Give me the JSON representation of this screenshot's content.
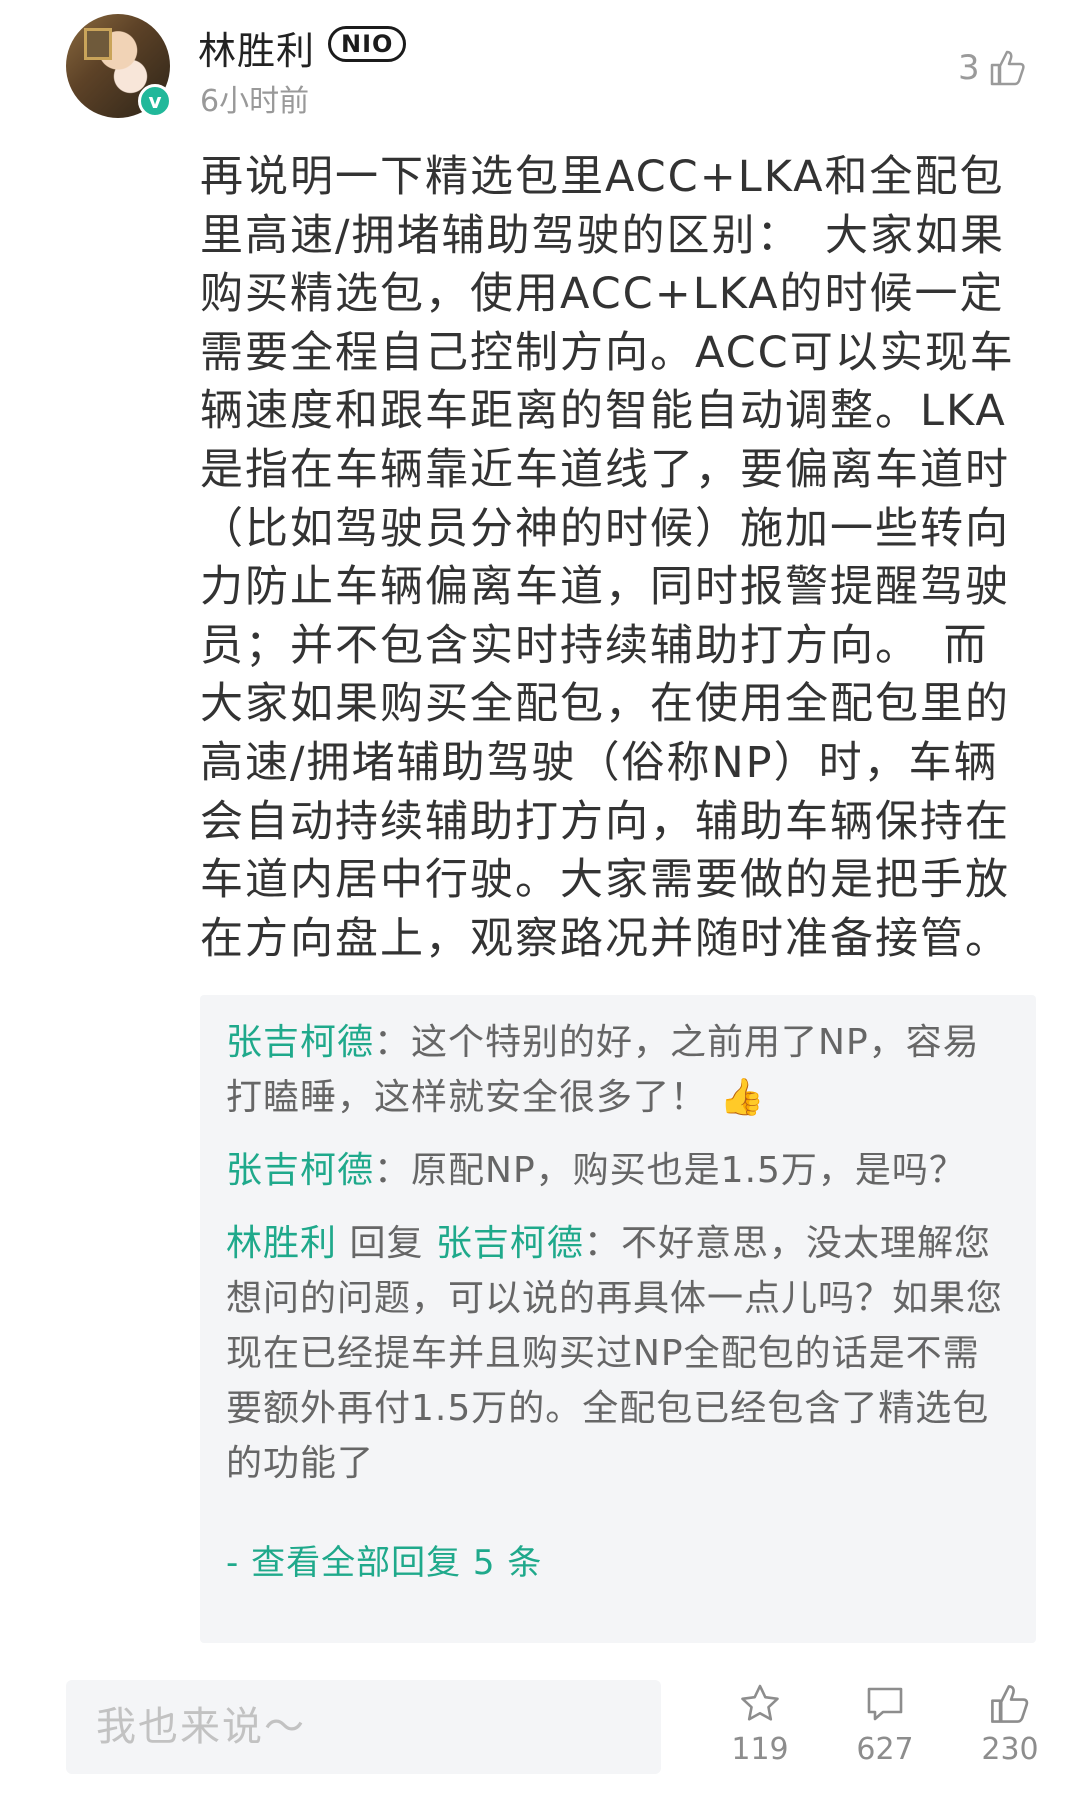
{
  "post": {
    "author": "林胜利",
    "brand": "NIO",
    "time": "6小时前",
    "like_count": "3",
    "content": "再说明一下精选包里ACC+LKA和全配包里高速/拥堵辅助驾驶的区别：　大家如果购买精选包，使用ACC+LKA的时候一定需要全程自己控制方向。ACC可以实现车辆速度和跟车距离的智能自动调整。LKA是指在车辆靠近车道线了，要偏离车道时（比如驾驶员分神的时候）施加一些转向力防止车辆偏离车道，同时报警提醒驾驶员；并不包含实时持续辅助打方向。　而大家如果购买全配包，在使用全配包里的高速/拥堵辅助驾驶（俗称NP）时，车辆会自动持续辅助打方向，辅助车辆保持在车道内居中行驶。大家需要做的是把手放在方向盘上，观察路况并随时准备接管。"
  },
  "replies": [
    {
      "author": "张吉柯德",
      "sep": "：",
      "text": "这个特别的好，之前用了NP，容易打瞌睡，这样就安全很多了！",
      "emoji": "👍"
    },
    {
      "author": "张吉柯德",
      "sep": "：",
      "text": "原配NP，购买也是1.5万，是吗？"
    },
    {
      "author": "林胜利",
      "verb": " 回复 ",
      "target": "张吉柯德",
      "sep": "：",
      "text": "不好意思，没太理解您想问的问题，可以说的再具体一点儿吗？如果您现在已经提车并且购买过NP全配包的话是不需要额外再付1.5万的。全配包已经包含了精选包的功能了"
    }
  ],
  "view_all": "- 查看全部回复 5 条",
  "bottom_bar": {
    "placeholder": "我也来说～",
    "favorites": "119",
    "comments": "627",
    "likes": "230"
  }
}
